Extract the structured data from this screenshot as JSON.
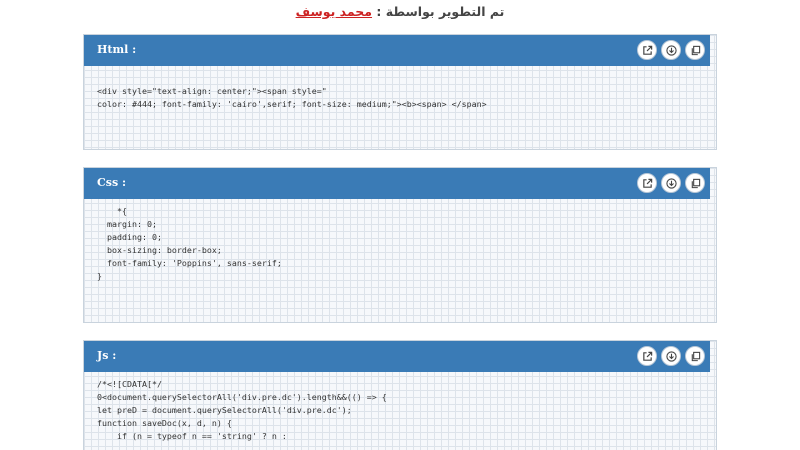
{
  "credit": {
    "prefix": "تم التطوير بواسطة : ",
    "author": "محمد يوسف"
  },
  "blocks": {
    "html": {
      "title": "Html :",
      "code": "<div style=\"text-align: center;\"><span style=\"\ncolor: #444; font-family: 'cairo',serif; font-size: medium;\"><b><span> </span>"
    },
    "css": {
      "title": "Css :",
      "code": "    *{\n  margin: 0;\n  padding: 0;\n  box-sizing: border-box;\n  font-family: 'Poppins', sans-serif;\n}"
    },
    "js": {
      "title": "Js :",
      "code": "/*<![CDATA[*/\n0<document.querySelectorAll('div.pre.dc').length&&(() => {\nlet preD = document.querySelectorAll('div.pre.dc');\nfunction saveDoc(x, d, n) {\n    if (n = typeof n == 'string' ? n :"
    }
  },
  "icons": [
    "open-new-window-icon",
    "download-icon",
    "copy-icon"
  ],
  "colors": {
    "header": "#3a7bb6",
    "author": "#cc2222",
    "grid": "#dde3ea"
  }
}
